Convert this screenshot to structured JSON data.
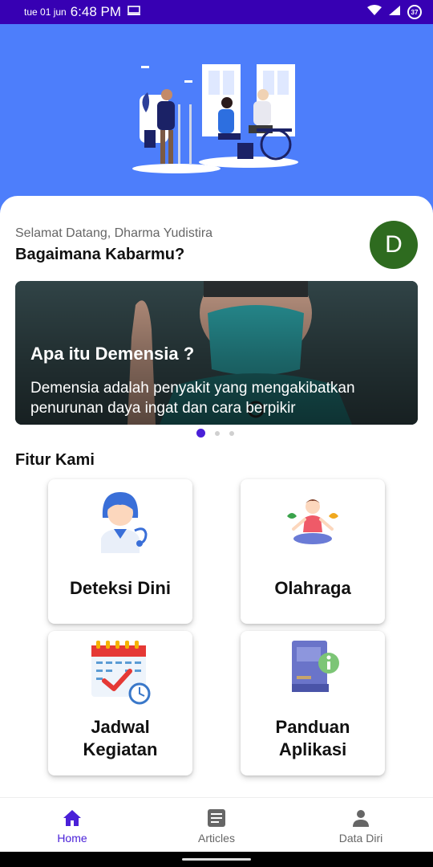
{
  "status_bar": {
    "date": "tue 01 jun",
    "time": "6:48 PM",
    "battery": "37"
  },
  "greeting": {
    "welcome": "Selamat Datang, Dharma Yudistira",
    "question": "Bagaimana Kabarmu?",
    "avatar_initial": "D"
  },
  "banner": {
    "title": "Apa itu Demensia ?",
    "description": "Demensia adalah penyakit yang mengakibatkan penurunan daya ingat dan cara berpikir",
    "slide_count": 3,
    "active_slide": 1
  },
  "features": {
    "section_title": "Fitur Kami",
    "items": [
      {
        "label": "Deteksi Dini",
        "icon": "doctor-icon"
      },
      {
        "label": "Olahraga",
        "icon": "yoga-icon"
      },
      {
        "label": "Jadwal Kegiatan",
        "icon": "calendar-icon"
      },
      {
        "label": "Panduan Aplikasi",
        "icon": "guide-book-icon"
      }
    ]
  },
  "bottom_nav": {
    "items": [
      {
        "label": "Home",
        "icon": "home-icon",
        "active": true
      },
      {
        "label": "Articles",
        "icon": "articles-icon",
        "active": false
      },
      {
        "label": "Data Diri",
        "icon": "person-icon",
        "active": false
      }
    ]
  },
  "colors": {
    "status_bar": "#3700b3",
    "hero": "#4d7efb",
    "accent": "#4a20d8",
    "avatar": "#2e6b1f"
  }
}
